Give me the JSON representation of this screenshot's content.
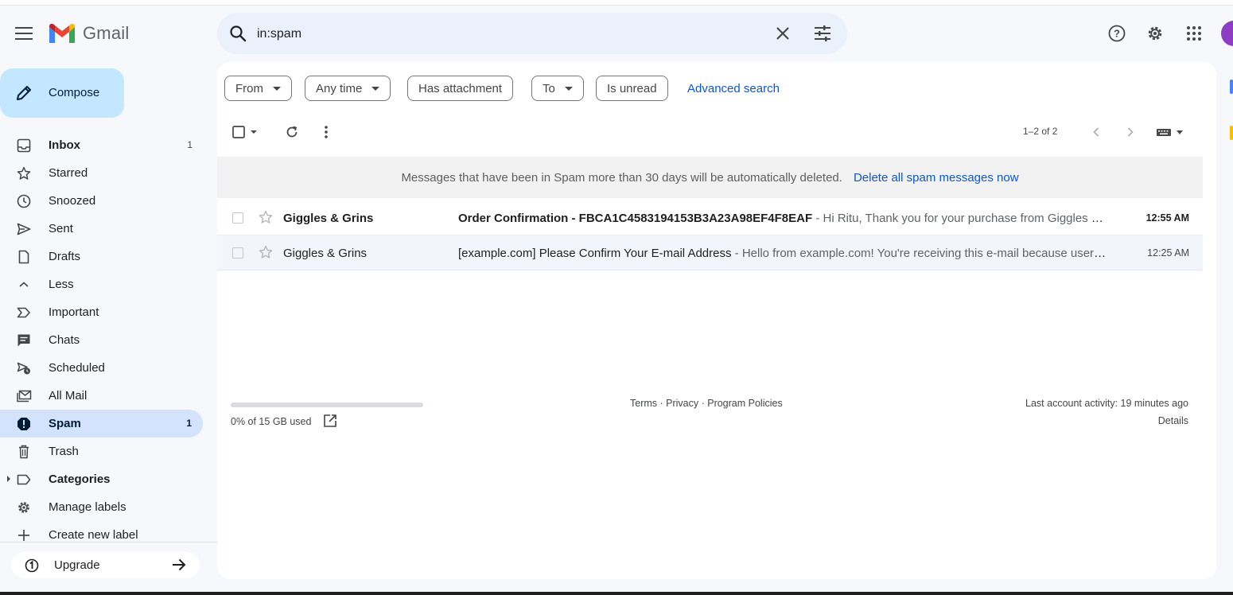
{
  "app": {
    "name": "Gmail"
  },
  "search": {
    "query": "in:spam"
  },
  "compose": {
    "label": "Compose"
  },
  "sidebar": {
    "items": [
      {
        "label": "Inbox",
        "count": "1",
        "icon": "inbox-icon"
      },
      {
        "label": "Starred",
        "count": "",
        "icon": "star-icon"
      },
      {
        "label": "Snoozed",
        "count": "",
        "icon": "clock-icon"
      },
      {
        "label": "Sent",
        "count": "",
        "icon": "send-icon"
      },
      {
        "label": "Drafts",
        "count": "",
        "icon": "draft-icon"
      },
      {
        "label": "Less",
        "count": "",
        "icon": "chevron-up-icon"
      },
      {
        "label": "Important",
        "count": "",
        "icon": "important-icon"
      },
      {
        "label": "Chats",
        "count": "",
        "icon": "chat-icon"
      },
      {
        "label": "Scheduled",
        "count": "",
        "icon": "scheduled-icon"
      },
      {
        "label": "All Mail",
        "count": "",
        "icon": "all-mail-icon"
      },
      {
        "label": "Spam",
        "count": "1",
        "icon": "spam-icon"
      },
      {
        "label": "Trash",
        "count": "",
        "icon": "trash-icon"
      },
      {
        "label": "Categories",
        "count": "",
        "icon": "label-icon"
      },
      {
        "label": "Manage labels",
        "count": "",
        "icon": "gear-icon"
      },
      {
        "label": "Create new label",
        "count": "",
        "icon": "plus-icon"
      }
    ],
    "upgrade": "Upgrade"
  },
  "filters": {
    "from": "From",
    "any_time": "Any time",
    "has_attachment": "Has attachment",
    "to": "To",
    "is_unread": "Is unread",
    "advanced": "Advanced search"
  },
  "toolbar": {
    "pager": "1–2 of 2"
  },
  "banner": {
    "text": "Messages that have been in Spam more than 30 days will be automatically deleted.",
    "action": "Delete all spam messages now"
  },
  "emails": [
    {
      "sender": "Giggles & Grins",
      "subject": "Order Confirmation - FBCA1C4583194153B3A23A98EF4F8EAF",
      "snippet": " - Hi Ritu, Thank you for your purchase from Giggles & Grins. Your order has been confirmed.",
      "time": "12:55 AM",
      "unread": true
    },
    {
      "sender": "Giggles & Grins",
      "subject": "[example.com] Please Confirm Your E-mail Address",
      "snippet": " - Hello from example.com! You're receiving this e-mail because user Ritu has given your e-mail address",
      "time": "12:25 AM",
      "unread": false
    }
  ],
  "footer": {
    "storage": "0% of 15 GB used",
    "storage_fraction": 0.0,
    "terms": "Terms",
    "privacy": "Privacy",
    "policies": "Program Policies",
    "sep": " · ",
    "activity": "Last account activity: 19 minutes ago",
    "details": "Details"
  },
  "colors": {
    "accent": "#0b57d0",
    "compose_bg": "#c2e7ff",
    "active_nav": "#d3e3fd",
    "search_bg": "#eaf1fb"
  }
}
